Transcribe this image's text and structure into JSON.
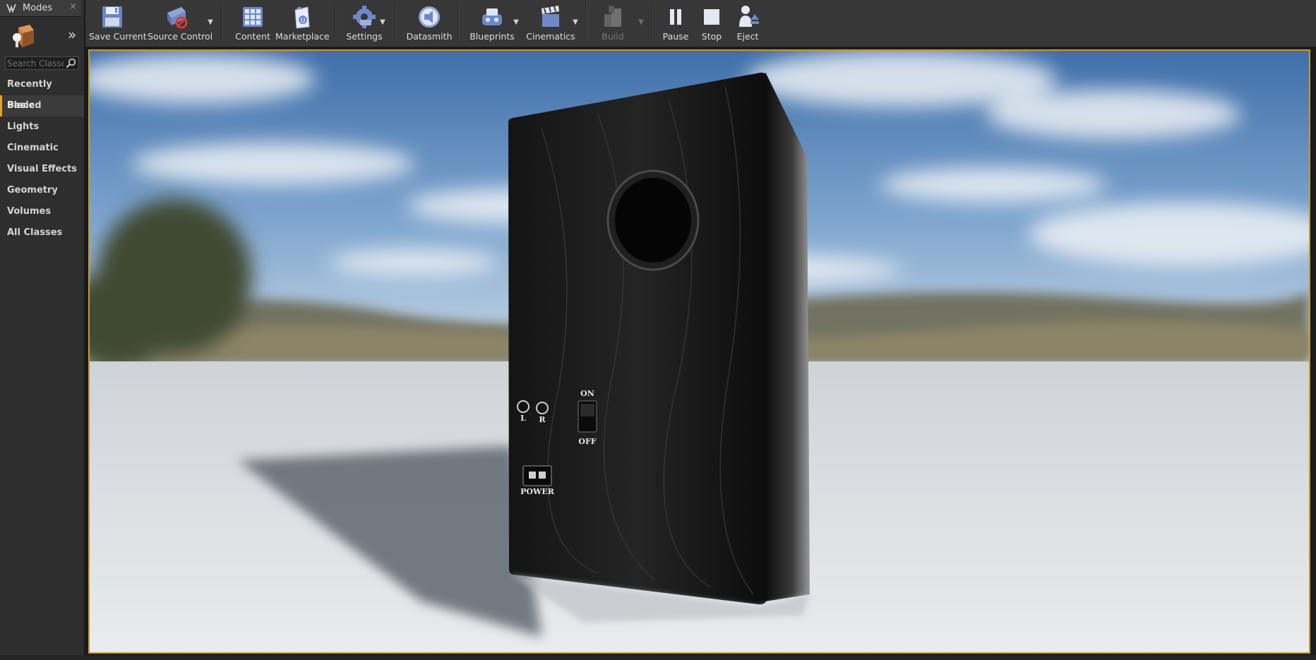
{
  "modes_panel": {
    "title": "Modes",
    "search": {
      "placeholder": "Search Classes",
      "value": ""
    },
    "categories": [
      {
        "label": "Recently Placed",
        "active": false
      },
      {
        "label": "Basic",
        "active": true
      },
      {
        "label": "Lights",
        "active": false
      },
      {
        "label": "Cinematic",
        "active": false
      },
      {
        "label": "Visual Effects",
        "active": false
      },
      {
        "label": "Geometry",
        "active": false
      },
      {
        "label": "Volumes",
        "active": false
      },
      {
        "label": "All Classes",
        "active": false
      }
    ]
  },
  "toolbar": {
    "save_current": "Save Current",
    "source_control": "Source Control",
    "content": "Content",
    "marketplace": "Marketplace",
    "settings": "Settings",
    "datasmith": "Datasmith",
    "blueprints": "Blueprints",
    "cinematics": "Cinematics",
    "build": "Build",
    "pause": "Pause",
    "stop": "Stop",
    "eject": "Eject"
  },
  "viewport": {
    "speaker_labels": {
      "left_jack": "L",
      "right_jack": "R",
      "switch_on": "ON",
      "switch_off": "OFF",
      "power": "POWER"
    }
  },
  "colors": {
    "accent_active_category": "#e3a22c",
    "viewport_border": "#c79a2c",
    "toolbar_bg": "#373737",
    "panel_bg": "#2e2e2e"
  }
}
